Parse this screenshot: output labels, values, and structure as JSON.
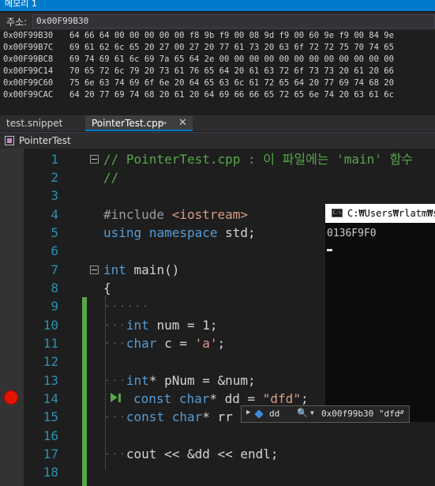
{
  "memory": {
    "title": "메모리 1",
    "address_label": "주소:",
    "address_value": "0x00F99B30",
    "rows": [
      {
        "addr": "0x00F99B30",
        "bytes": "64 66 64 00 00 00 00 00 f8 9b f9 00 08 9d f9 00 60 9e f9 00 84 9e"
      },
      {
        "addr": "0x00F99B7C",
        "bytes": "69 61 62 6c 65 20 27 00 27 20 77 61 73 20 63 6f 72 72 75 70 74 65"
      },
      {
        "addr": "0x00F99BC8",
        "bytes": "69 74 69 61 6c 69 7a 65 64 2e 00 00 00 00 00 00 00 00 00 00 00 00"
      },
      {
        "addr": "0x00F99C14",
        "bytes": "70 65 72 6c 79 20 73 61 76 65 64 20 61 63 72 6f 73 73 20 61 20 66"
      },
      {
        "addr": "0x00F99C60",
        "bytes": "75 6e 63 74 69 6f 6e 20 64 65 63 6c 61 72 65 64 20 77 69 74 68 20"
      },
      {
        "addr": "0x00F99CAC",
        "bytes": "64 20 77 69 74 68 20 61 20 64 69 66 66 65 72 65 6e 74 20 63 61 6c"
      }
    ]
  },
  "tabs": [
    {
      "label": "test.snippet"
    },
    {
      "label": "PointerTest.cpp",
      "pin": "⊸",
      "close": "✕"
    }
  ],
  "nav": {
    "scope": "PointerTest"
  },
  "editor": {
    "line_numbers": [
      "1",
      "2",
      "3",
      "4",
      "5",
      "6",
      "7",
      "8",
      "9",
      "10",
      "11",
      "12",
      "13",
      "14",
      "15",
      "16",
      "17",
      "18"
    ],
    "comment_line1": "// PointerTest.cpp : 이 파일에는 'main' 함수",
    "comment_line2": "//",
    "include_directive": "#include",
    "include_header": "<iostream>",
    "using_kw": "using",
    "namespace_kw": "namespace",
    "using_rest": " std;",
    "int_kw": "int",
    "main_sig": " main()",
    "open_brace": "{",
    "ws_dots": "······",
    "ws_indent": "···",
    "line10_int": "int",
    "line10_rest": " num = 1;",
    "line11_char": "char",
    "line11_rest": " c = ",
    "line11_str": "'a'",
    "line11_end": ";",
    "line13_int": "int",
    "line13_rest": "* pNum = &num;",
    "line14_const": "const",
    "line14_char": "char",
    "line14_rest": "* dd = ",
    "line14_str": "\"dfd\"",
    "line14_end": ";",
    "line15_const": "const",
    "line15_char": "char",
    "line15_rest": "* rr",
    "line17_code": "cout << &dd << endl;"
  },
  "console": {
    "title": "C:₩Users₩rlatm₩source",
    "output": "0136F9F0",
    "icon": "C:\\"
  },
  "datatip": {
    "name": "dd",
    "value": "0x00f99b30 \"dfd\"",
    "expand_glyph": "▶",
    "search_glyph": "🔍",
    "dropdown_glyph": "▼",
    "pin_glyph": "⊸"
  }
}
